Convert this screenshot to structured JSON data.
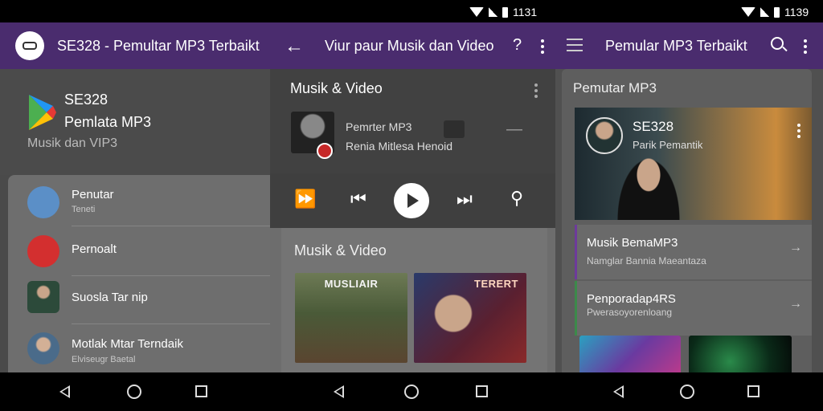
{
  "status": {
    "time_1": "1131",
    "time_2": "1139"
  },
  "panel1": {
    "appbar_title": "SE328 - Pemultar MP3 Terbaikt",
    "header": {
      "name": "SE328",
      "subtitle": "Pemlata MP3",
      "tagline": "Musik dan VIP3"
    },
    "items": [
      {
        "label": "Penutar",
        "sub": "Teneti"
      },
      {
        "label": "Pernoalt",
        "sub": ""
      },
      {
        "label": "Suosla Tar nip",
        "sub": ""
      },
      {
        "label": "Motlak Mtar Terndaik",
        "sub": "Elviseugr Baetal"
      }
    ]
  },
  "panel2": {
    "appbar_title": "Viur paur Musik dan Video",
    "help_glyph": "?",
    "now_title": "Musik & Video",
    "now_name": "Pemrter MP3",
    "now_artist": "Renia Mitlesa Henoid",
    "grid_title": "Musik & Video",
    "tiles": [
      {
        "caption": "MUSLIAIR"
      },
      {
        "caption": "TERERT"
      }
    ]
  },
  "panel3": {
    "appbar_title": "Pemular MP3 Terbaikt",
    "section_title": "Pemutar MP3",
    "feature": {
      "name": "SE328",
      "sub": "Parik Pemantik"
    },
    "rows": [
      {
        "title": "Musik BemaMP3",
        "sub": "Namglar Bannia Maeantaza"
      },
      {
        "title": "Penporadap4RS",
        "sub": "Pwerasoyorenloang"
      }
    ]
  },
  "colors": {
    "appbar": "#4a2c6e",
    "accent_red": "#c62828"
  }
}
